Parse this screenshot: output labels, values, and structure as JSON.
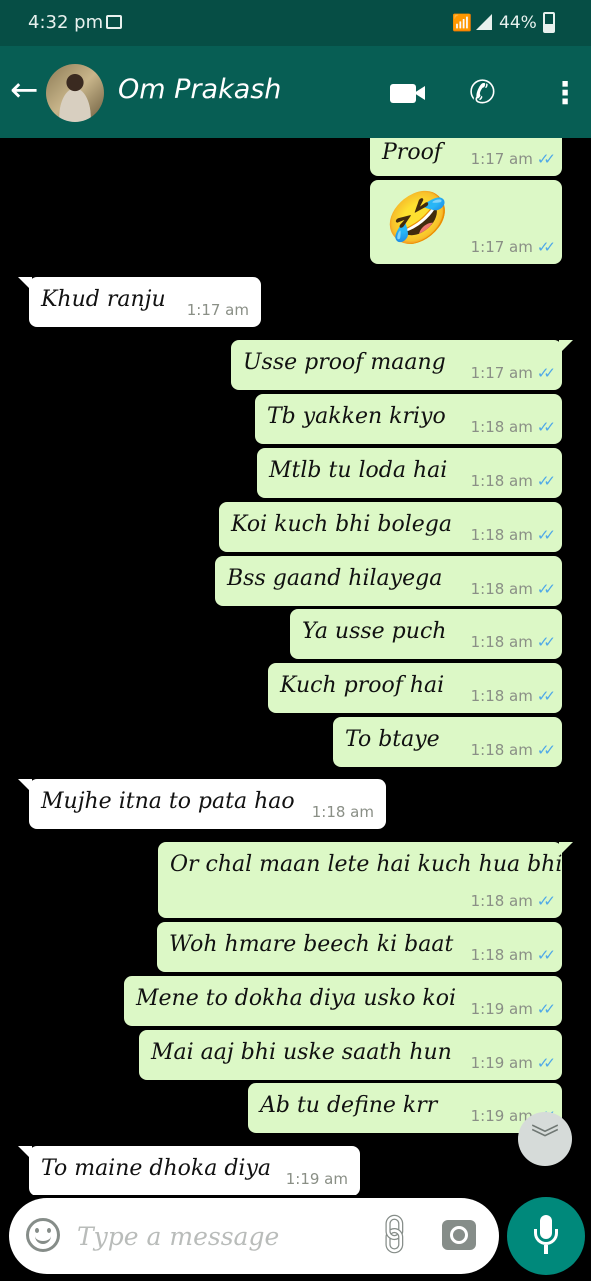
{
  "status_bar": {
    "time": "4:32 pm",
    "battery": "44%"
  },
  "header": {
    "contact_name": "Om Prakash"
  },
  "messages": [
    {
      "dir": "out",
      "text": "Proof",
      "time": "1:17 am"
    },
    {
      "dir": "out",
      "emoji": "🤣",
      "time": "1:17 am"
    },
    {
      "dir": "in",
      "text": "Khud ranju",
      "time": "1:17 am"
    },
    {
      "dir": "out",
      "text": "Usse proof maang",
      "time": "1:17 am"
    },
    {
      "dir": "out",
      "text": "Tb yakken kriyo",
      "time": "1:18 am"
    },
    {
      "dir": "out",
      "text": "Mtlb tu loda hai",
      "time": "1:18 am"
    },
    {
      "dir": "out",
      "text": "Koi kuch bhi bolega",
      "time": "1:18 am"
    },
    {
      "dir": "out",
      "text": "Bss gaand hilayega",
      "time": "1:18 am"
    },
    {
      "dir": "out",
      "text": "Ya usse puch",
      "time": "1:18 am"
    },
    {
      "dir": "out",
      "text": "Kuch proof hai",
      "time": "1:18 am"
    },
    {
      "dir": "out",
      "text": "To btaye",
      "time": "1:18 am"
    },
    {
      "dir": "in",
      "text": "Mujhe itna to pata hao",
      "time": "1:18 am"
    },
    {
      "dir": "out",
      "text": "Or chal maan lete hai kuch hua bhi",
      "time": "1:18 am"
    },
    {
      "dir": "out",
      "text": "Woh hmare beech ki baat",
      "time": "1:18 am"
    },
    {
      "dir": "out",
      "text": "Mene to dokha diya usko koi",
      "time": "1:19 am"
    },
    {
      "dir": "out",
      "text": "Mai aaj bhi uske saath hun",
      "time": "1:19 am"
    },
    {
      "dir": "out",
      "text": "Ab tu define krr",
      "time": "1:19 am"
    },
    {
      "dir": "in",
      "text": "To maine dhoka diya",
      "time": "1:19 am"
    }
  ],
  "input": {
    "placeholder": "Type a message"
  },
  "colors": {
    "header": "#075e54",
    "status_bar": "#064e45",
    "outgoing_bubble": "#dcf8c6",
    "incoming_bubble": "#ffffff",
    "read_ticks": "#4fa8e8",
    "mic_button": "#00897b"
  },
  "icons": [
    "back-arrow-icon",
    "video-call-icon",
    "phone-icon",
    "more-vert-icon",
    "double-chevron-down-icon",
    "emoji-icon",
    "attach-icon",
    "camera-icon",
    "mic-icon"
  ]
}
